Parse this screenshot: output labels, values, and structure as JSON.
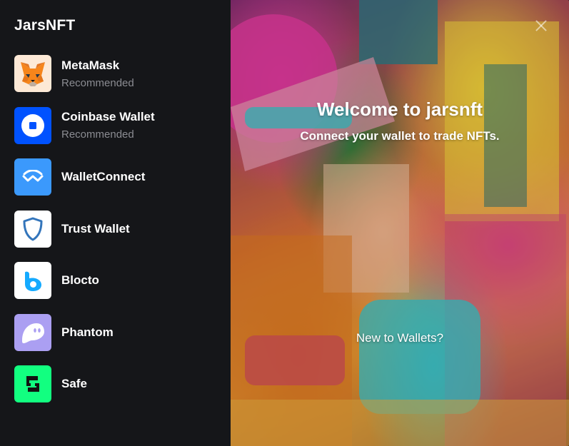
{
  "app": {
    "title": "JarsNFT"
  },
  "wallets": [
    {
      "name": "MetaMask",
      "sub": "Recommended",
      "icon": "metamask-fox-icon",
      "bg": "#fde9d6"
    },
    {
      "name": "Coinbase Wallet",
      "sub": "Recommended",
      "icon": "coinbase-icon",
      "bg": "#0052ff"
    },
    {
      "name": "WalletConnect",
      "sub": "",
      "icon": "walletconnect-icon",
      "bg": "#3b99fc"
    },
    {
      "name": "Trust Wallet",
      "sub": "",
      "icon": "trust-shield-icon",
      "bg": "#ffffff"
    },
    {
      "name": "Blocto",
      "sub": "",
      "icon": "blocto-icon",
      "bg": "#ffffff"
    },
    {
      "name": "Phantom",
      "sub": "",
      "icon": "phantom-ghost-icon",
      "bg": "#ab9ff2"
    },
    {
      "name": "Safe",
      "sub": "",
      "icon": "safe-icon",
      "bg": "#12ff80"
    }
  ],
  "hero": {
    "title": "Welcome to jarsnft",
    "subtitle": "Connect your wallet to trade NFTs.",
    "new_to_wallets": "New to Wallets?"
  },
  "colors": {
    "sidebar_bg": "#151619",
    "secondary_text": "#8b8c92"
  }
}
